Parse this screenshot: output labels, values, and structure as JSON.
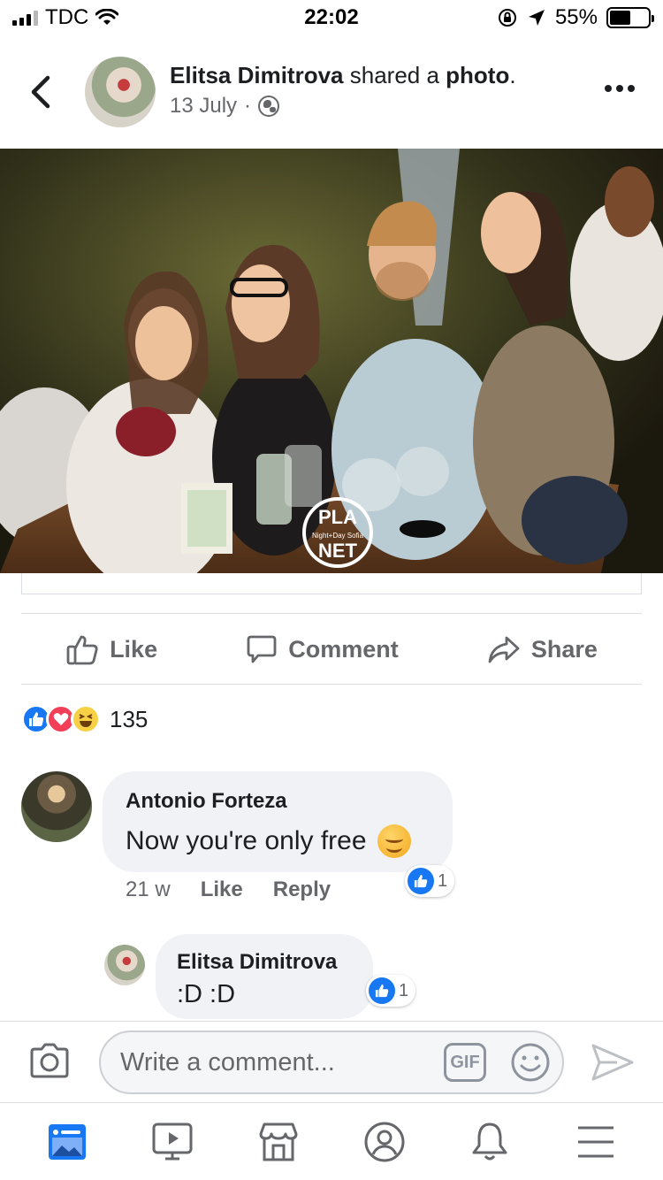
{
  "status_bar": {
    "carrier": "TDC",
    "time": "22:02",
    "battery": "55%",
    "battery_level": 0.55
  },
  "post": {
    "author": "Elitsa Dimitrova",
    "action_text": " shared a ",
    "object": "photo",
    "punct": ".",
    "date": "13 July",
    "separator": "·",
    "photo_watermark": "PLANET Night+Day Sofia"
  },
  "actions": {
    "like": "Like",
    "comment": "Comment",
    "share": "Share"
  },
  "reactions": {
    "count": "135",
    "types": [
      "like",
      "love",
      "haha"
    ]
  },
  "comments": [
    {
      "author": "Antonio Forteza",
      "text": "Now you're only free",
      "emoji": "smiling-face",
      "time": "21 w",
      "like_label": "Like",
      "reply_label": "Reply",
      "like_count": "1"
    },
    {
      "author": "Elitsa Dimitrova",
      "text": ":D :D",
      "like_count": "1"
    }
  ],
  "composer": {
    "placeholder": "Write a comment...",
    "gif_label": "GIF"
  },
  "tabbar": {
    "items": [
      "news-feed-icon",
      "watch-icon",
      "marketplace-icon",
      "profile-icon",
      "notifications-icon",
      "menu-icon"
    ],
    "active": "news-feed-icon",
    "accent": "#1877f2"
  },
  "colors": {
    "accent": "#1877f2",
    "text": "#1c1e21",
    "secondary": "#65676b",
    "bubble": "#f0f2f5"
  }
}
